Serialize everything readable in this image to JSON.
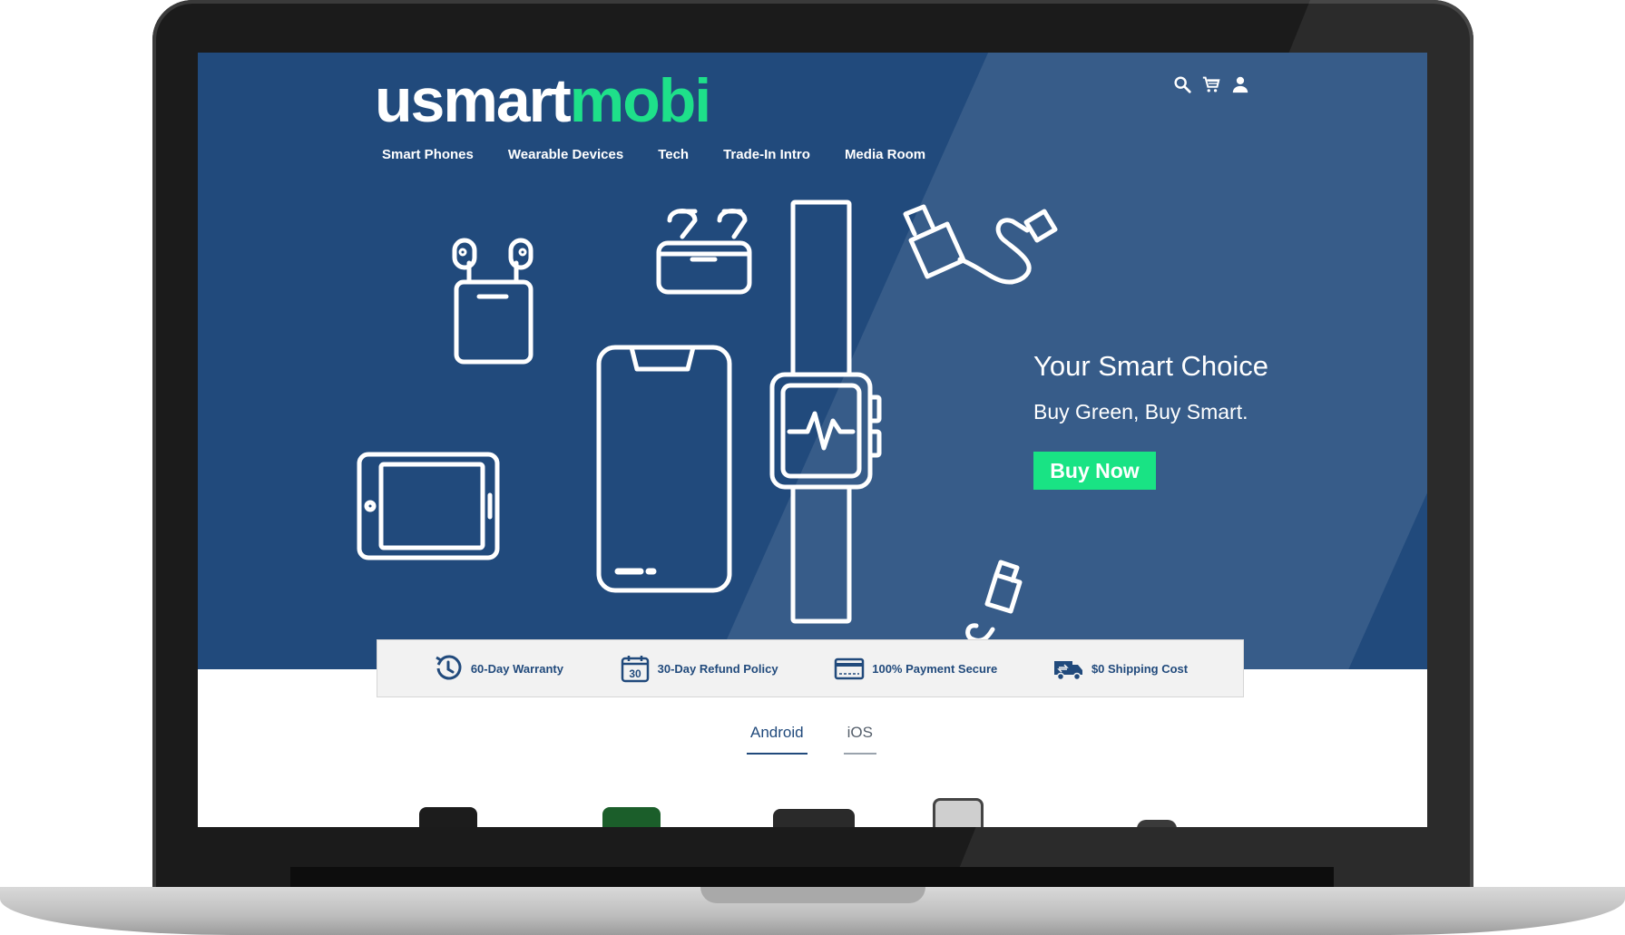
{
  "site": {
    "logo_part1": "usmart",
    "logo_part2": "mobi"
  },
  "nav": {
    "items": [
      "Smart Phones",
      "Wearable Devices",
      "Tech",
      "Trade-In Intro",
      "Media Room"
    ]
  },
  "header_icons": [
    "search-icon",
    "cart-icon",
    "user-icon"
  ],
  "hero": {
    "title": "Your Smart Choice",
    "subtitle": "Buy Green, Buy Smart.",
    "cta": "Buy Now"
  },
  "features": [
    {
      "icon": "warranty-clock-icon",
      "label": "60-Day Warranty"
    },
    {
      "icon": "refund-calendar-icon",
      "label": "30-Day Refund Policy",
      "badge": "30"
    },
    {
      "icon": "credit-card-icon",
      "label": "100% Payment Secure"
    },
    {
      "icon": "shipping-truck-icon",
      "label": "$0 Shipping Cost"
    }
  ],
  "tabs": [
    {
      "label": "Android",
      "active": true
    },
    {
      "label": "iOS",
      "active": false
    }
  ],
  "colors": {
    "hero_bg": "#214a7c",
    "accent_green": "#19e384",
    "logo_green": "#1ee08a"
  }
}
